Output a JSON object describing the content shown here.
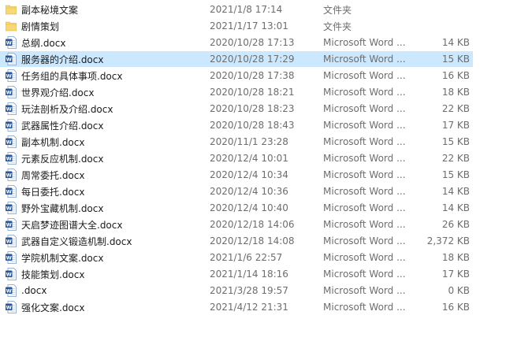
{
  "colors": {
    "selected_row": "#cce8ff",
    "folder": "#f8d775",
    "word": "#2b5797"
  },
  "files": [
    {
      "name": "副本秘境文案",
      "date": "2021/1/8 17:14",
      "type": "文件夹",
      "size": "",
      "icon": "folder-icon"
    },
    {
      "name": "剧情策划",
      "date": "2021/1/17 13:01",
      "type": "文件夹",
      "size": "",
      "icon": "folder-icon"
    },
    {
      "name": "总纲.docx",
      "date": "2020/10/28 17:13",
      "type": "Microsoft Word ...",
      "size": "14 KB",
      "icon": "word-document-icon"
    },
    {
      "name": "服务器的介绍.docx",
      "date": "2020/10/28 17:29",
      "type": "Microsoft Word ...",
      "size": "15 KB",
      "icon": "word-document-icon",
      "selected": true
    },
    {
      "name": "任务组的具体事项.docx",
      "date": "2020/10/28 17:38",
      "type": "Microsoft Word ...",
      "size": "16 KB",
      "icon": "word-document-icon"
    },
    {
      "name": "世界观介绍.docx",
      "date": "2020/10/28 18:21",
      "type": "Microsoft Word ...",
      "size": "18 KB",
      "icon": "word-document-icon"
    },
    {
      "name": "玩法剖析及介绍.docx",
      "date": "2020/10/28 18:23",
      "type": "Microsoft Word ...",
      "size": "22 KB",
      "icon": "word-document-icon"
    },
    {
      "name": "武器属性介绍.docx",
      "date": "2020/10/28 18:43",
      "type": "Microsoft Word ...",
      "size": "17 KB",
      "icon": "word-document-icon"
    },
    {
      "name": "副本机制.docx",
      "date": "2020/11/1 23:28",
      "type": "Microsoft Word ...",
      "size": "15 KB",
      "icon": "word-document-icon"
    },
    {
      "name": "元素反应机制.docx",
      "date": "2020/12/4 10:01",
      "type": "Microsoft Word ...",
      "size": "22 KB",
      "icon": "word-document-icon"
    },
    {
      "name": "周常委托.docx",
      "date": "2020/12/4 10:34",
      "type": "Microsoft Word ...",
      "size": "15 KB",
      "icon": "word-document-icon"
    },
    {
      "name": "每日委托.docx",
      "date": "2020/12/4 10:36",
      "type": "Microsoft Word ...",
      "size": "14 KB",
      "icon": "word-document-icon"
    },
    {
      "name": "野外宝藏机制.docx",
      "date": "2020/12/4 10:40",
      "type": "Microsoft Word ...",
      "size": "14 KB",
      "icon": "word-document-icon"
    },
    {
      "name": "天启梦迹图谱大全.docx",
      "date": "2020/12/18 14:06",
      "type": "Microsoft Word ...",
      "size": "26 KB",
      "icon": "word-document-icon"
    },
    {
      "name": "武器自定义锻造机制.docx",
      "date": "2020/12/18 14:08",
      "type": "Microsoft Word ...",
      "size": "2,372 KB",
      "icon": "word-document-icon"
    },
    {
      "name": "学院机制文案.docx",
      "date": "2021/1/6 22:57",
      "type": "Microsoft Word ...",
      "size": "18 KB",
      "icon": "word-document-icon"
    },
    {
      "name": "技能策划.docx",
      "date": "2021/1/14 18:16",
      "type": "Microsoft Word ...",
      "size": "17 KB",
      "icon": "word-document-icon"
    },
    {
      "name": ".docx",
      "date": "2021/3/28 19:57",
      "type": "Microsoft Word ...",
      "size": "0 KB",
      "icon": "word-document-icon"
    },
    {
      "name": "强化文案.docx",
      "date": "2021/4/12 21:31",
      "type": "Microsoft Word ...",
      "size": "16 KB",
      "icon": "word-document-icon"
    }
  ]
}
